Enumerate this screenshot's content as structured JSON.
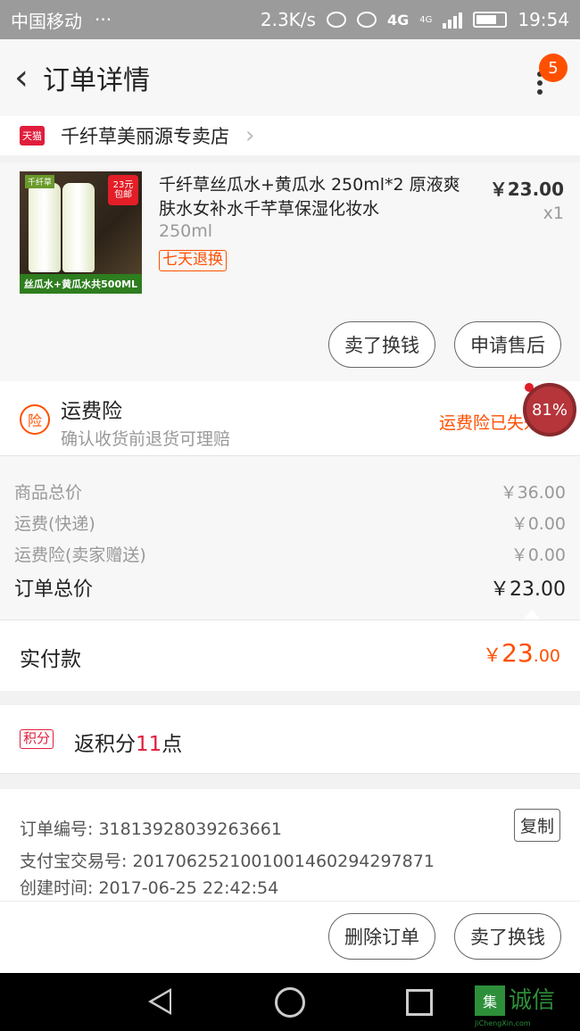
{
  "status_bar": {
    "carrier": "中国移动",
    "more": "···",
    "speed": "2.3K/s",
    "network": "4G",
    "network2": "4G",
    "time": "19:54"
  },
  "header": {
    "title": "订单详情",
    "badge_count": "5"
  },
  "shop": {
    "platform_tag": "天猫",
    "name": "千纤草美丽源专卖店"
  },
  "product": {
    "title": "千纤草丝瓜水+黄瓜水 250ml*2 原液爽肤水女补水千芊草保湿化妆水",
    "sku": "250ml",
    "badge": "七天退换",
    "price": "￥23.00",
    "qty": "x1",
    "image": {
      "top_label": "千纤草",
      "tag_line1": "23元",
      "tag_line2": "包邮",
      "banner": "丝瓜水+黄瓜水共500ML"
    },
    "buttons": [
      "卖了换钱",
      "申请售后"
    ]
  },
  "insurance": {
    "icon": "险",
    "title": "运费险",
    "subtitle": "确认收货前退货可理赔",
    "status": "运费险已失效",
    "progress_label": "81%"
  },
  "totals": [
    {
      "label": "商品总价",
      "value": "￥36.00"
    },
    {
      "label": "运费(快递)",
      "value": "￥0.00"
    },
    {
      "label": "运费险(卖家赠送)",
      "value": "￥0.00"
    },
    {
      "label": "订单总价",
      "value": "￥23.00"
    }
  ],
  "paid": {
    "label": "实付款",
    "currency": "￥",
    "integer": "23",
    "decimal": ".00"
  },
  "points": {
    "icon": "积分",
    "prefix": "返积分",
    "count": "11",
    "suffix": "点"
  },
  "order_info": {
    "order_no": "订单编号: 31813928039263661",
    "alipay_no": "支付宝交易号: 2017062521001001460294297871",
    "created": "创建时间: 2017-06-25 22:42:54",
    "copy_label": "复制"
  },
  "bottom_bar": {
    "buttons": [
      "删除订单",
      "卖了换钱"
    ]
  },
  "watermark": {
    "logo": "集",
    "text": "诚信",
    "sub": "JiChengXin.com"
  },
  "colors": {
    "accent": "#ff5000",
    "tmall_red": "#e01e3c"
  }
}
